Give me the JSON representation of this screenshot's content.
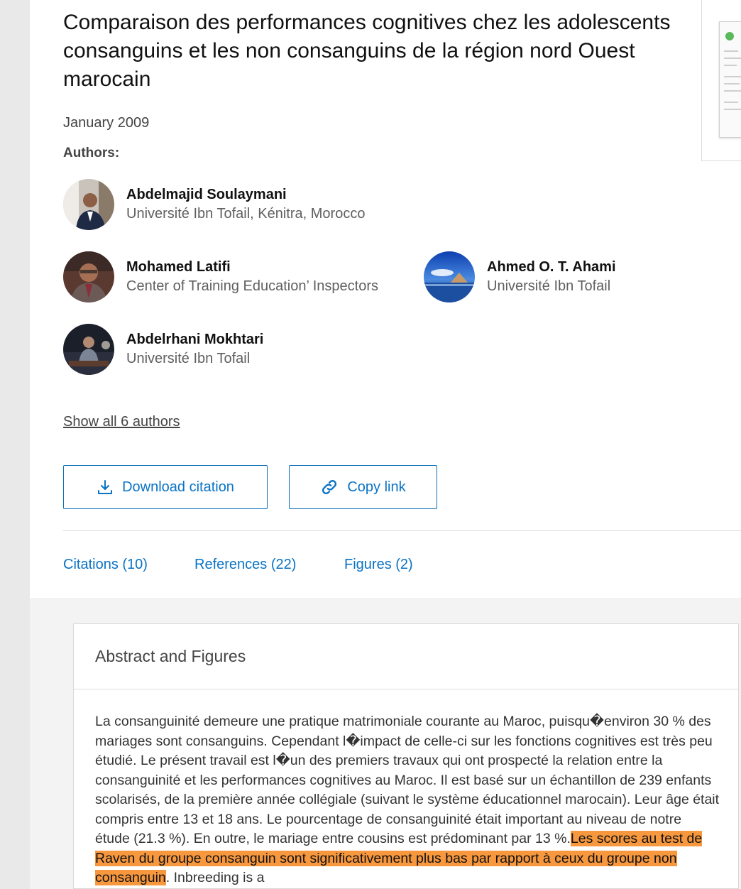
{
  "article": {
    "title": "Comparaison des performances cognitives chez les adolescents consanguins et les non consanguins de la région nord Ouest marocain",
    "date": "January 2009",
    "authors_label": "Authors:"
  },
  "authors": [
    {
      "name": "Abdelmajid Soulaymani",
      "affiliation": "Université Ibn Tofail, Kénitra, Morocco"
    },
    {
      "name": "Mohamed Latifi",
      "affiliation": "Center of Training Education’ Inspectors"
    },
    {
      "name": "Ahmed O. T. Ahami",
      "affiliation": "Université Ibn Tofail"
    },
    {
      "name": "Abdelrhani Mokhtari",
      "affiliation": "Université Ibn Tofail"
    }
  ],
  "show_all_authors": "Show all 6 authors",
  "actions": {
    "download_citation": "Download citation",
    "copy_link": "Copy link"
  },
  "tabs": [
    "Citations (10)",
    "References (22)",
    "Figures (2)"
  ],
  "abstract_section": {
    "title": "Abstract and Figures",
    "text_before": "La consanguinité demeure une pratique matrimoniale courante au Maroc, puisqu�environ 30 % des mariages sont consanguins. Cependant l�impact de celle-ci sur les fonctions cognitives est très peu étudié. Le présent travail est l�un des premiers travaux qui ont prospecté la relation entre la consanguinité et les performances cognitives au Maroc. Il est basé sur un échantillon de 239 enfants scolarisés, de la première année collégiale (suivant le système éducationnel marocain). Leur âge était compris entre 13 et 18 ans. Le pourcentage de consanguinité était important au niveau de notre étude (21.3 %). En outre, le mariage entre cousins est prédominant par 13 %.",
    "text_highlight": "Les scores au test de Raven du groupe consanguin sont significativement plus bas par rapport à ceux du groupe non consanguin",
    "text_after": ". Inbreeding is a"
  },
  "colors": {
    "link_blue": "#0a73c5",
    "highlight_orange": "#f7983f"
  },
  "icons": {
    "download": "download-icon",
    "link": "link-icon"
  }
}
